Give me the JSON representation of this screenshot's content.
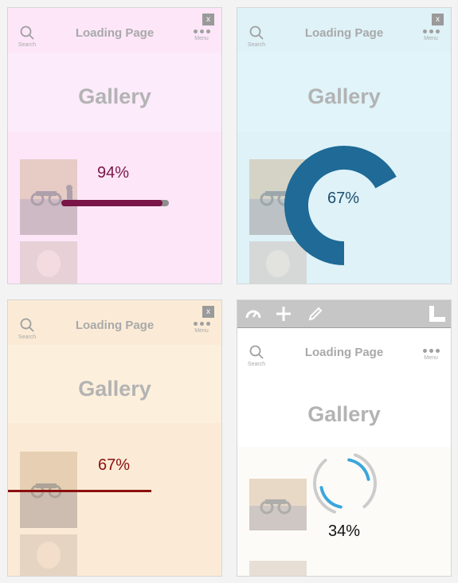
{
  "panels": [
    {
      "close": "x",
      "app_title": "Loading Page",
      "search_label": "Search",
      "menu_label": "Menu",
      "heading": "Gallery",
      "percent": "94%",
      "progress": 0.94,
      "loader": "linear-bar",
      "accent": "#7a1547"
    },
    {
      "close": "x",
      "app_title": "Loading Page",
      "search_label": "Search",
      "menu_label": "Menu",
      "heading": "Gallery",
      "percent": "67%",
      "progress": 0.67,
      "loader": "thick-ring",
      "accent": "#1f6a96"
    },
    {
      "close": "x",
      "app_title": "Loading Page",
      "search_label": "Search",
      "menu_label": "Menu",
      "heading": "Gallery",
      "percent": "67%",
      "progress": 0.67,
      "loader": "thin-line",
      "accent": "#8c0f0f"
    },
    {
      "app_title": "Loading Page",
      "search_label": "Search",
      "menu_label": "Menu",
      "heading": "Gallery",
      "percent": "34%",
      "progress": 0.34,
      "loader": "arc-spinner",
      "accent": "#3aa6dc"
    }
  ],
  "editor_toolbar": {
    "icons": [
      "dashboard-icon",
      "plus-icon",
      "pencil-icon",
      "wordpress-logo"
    ]
  }
}
